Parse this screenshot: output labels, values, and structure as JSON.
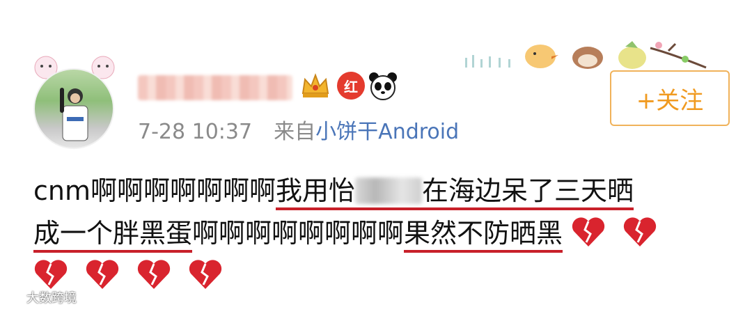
{
  "post": {
    "username_blurred": true,
    "timestamp": "7-28 10:37",
    "source_prefix": "来自",
    "source": "小饼干Android",
    "red_badge_text": "红",
    "follow_button": "+关注",
    "content": {
      "line1_a": "cnm啊啊啊啊啊啊啊",
      "line1_hl_a": "我用怡",
      "line1_hl_b": "在海边呆了三天晒",
      "line2_hl": "成一个胖黑蛋",
      "line2_b": "啊啊啊啊啊啊啊啊",
      "line2_hl_2": "果然不防晒黑"
    },
    "emoji": "broken-heart"
  },
  "watermark": "大数跨境",
  "colors": {
    "accent_orange": "#f09a20",
    "link_blue": "#4a75b8",
    "underline_red": "#c8202a"
  }
}
